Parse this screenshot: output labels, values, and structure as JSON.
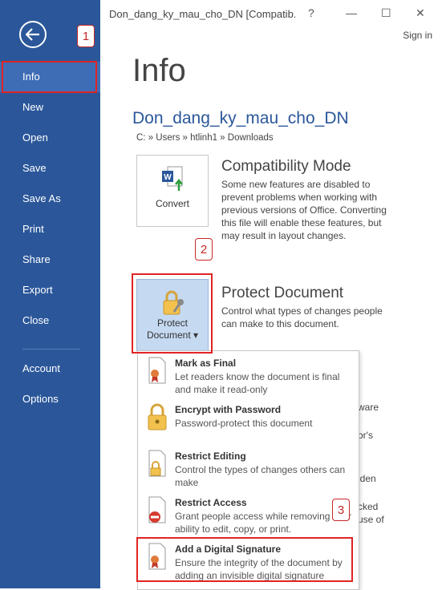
{
  "window": {
    "title": "Don_dang_ky_mau_cho_DN [Compatib...",
    "help_glyph": "?",
    "minimize_glyph": "—",
    "maximize_glyph": "☐",
    "close_glyph": "✕",
    "sign_in": "Sign in"
  },
  "sidebar": {
    "items": [
      {
        "label": "Info",
        "active": true
      },
      {
        "label": "New"
      },
      {
        "label": "Open"
      },
      {
        "label": "Save"
      },
      {
        "label": "Save As"
      },
      {
        "label": "Print"
      },
      {
        "label": "Share"
      },
      {
        "label": "Export"
      },
      {
        "label": "Close"
      },
      {
        "label": "Account"
      },
      {
        "label": "Options"
      }
    ]
  },
  "main": {
    "title": "Info",
    "doc_name": "Don_dang_ky_mau_cho_DN",
    "doc_path": "C: » Users » htlinh1 » Downloads",
    "compat": {
      "button_label": "Convert",
      "title": "Compatibility Mode",
      "desc": "Some new features are disabled to prevent problems when working with previous versions of Office. Converting this file will enable these features, but may result in layout changes."
    },
    "protect": {
      "button_label_line1": "Protect",
      "button_label_line2": "Document ▾",
      "title": "Protect Document",
      "desc": "Control what types of changes people can make to this document."
    },
    "background_fragments": [
      "ware",
      "or's",
      "lden",
      "cked",
      "use of"
    ]
  },
  "dropdown": {
    "items": [
      {
        "title": "Mark as Final",
        "desc": "Let readers know the document is final and make it read-only",
        "icon": "ribbon-document-icon"
      },
      {
        "title": "Encrypt with Password",
        "desc": "Password-protect this document",
        "icon": "lock-icon"
      },
      {
        "title": "Restrict Editing",
        "desc": "Control the types of changes others can make",
        "icon": "lock-document-icon"
      },
      {
        "title": "Restrict Access",
        "desc": "Grant people access while removing their ability to edit, copy, or print.",
        "icon": "no-entry-document-icon"
      },
      {
        "title": "Add a Digital Signature",
        "desc": "Ensure the integrity of the document by adding an invisible digital signature",
        "icon": "signature-ribbon-icon"
      }
    ]
  },
  "callouts": [
    "1",
    "2",
    "3"
  ],
  "colors": {
    "sidebar_bg": "#2b579a",
    "sidebar_active": "#3e6db5",
    "accent_blue": "#2b579a",
    "callout_red": "#e02424",
    "protect_btn_bg": "#c5d9f1"
  }
}
